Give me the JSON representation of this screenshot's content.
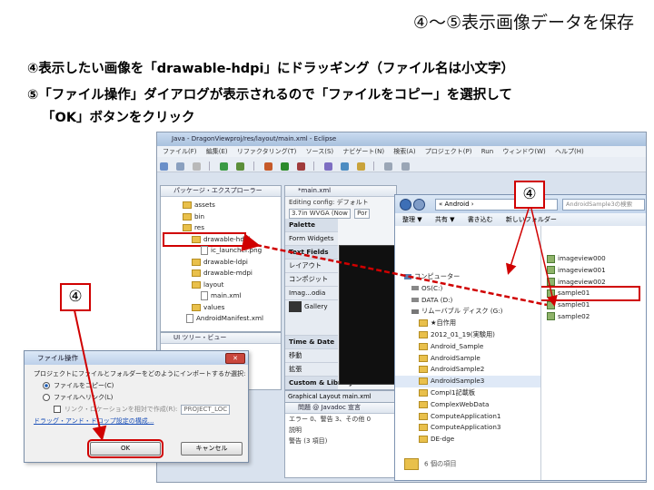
{
  "slide": {
    "title": "④～⑤表示画像データを保存",
    "instruction_1": "④表示したい画像を「drawable-hdpi」にドラッギング（ファイル名は小文字）",
    "instruction_2": "⑤「ファイル操作」ダイアログが表示されるので「ファイルをコピー」を選択して",
    "instruction_2b": "「OK」ボタンをクリック"
  },
  "callouts": {
    "left": "④",
    "right": "④"
  },
  "eclipse": {
    "title": "Java - DragonViewproj/res/layout/main.xml - Eclipse",
    "menu": [
      "ファイル(F)",
      "編集(E)",
      "リファクタリング(T)",
      "ソース(S)",
      "ナビゲート(N)",
      "検索(A)",
      "プロジェクト(P)",
      "Run",
      "ウィンドウ(W)",
      "ヘルプ(H)"
    ],
    "package_explorer_title": "パッケージ・エクスプローラー",
    "tree": [
      "assets",
      "bin",
      "res",
      "drawable-hdpi",
      "ic_launcher.png",
      "drawable-ldpi",
      "drawable-mdpi",
      "layout",
      "main.xml",
      "values",
      "AndroidManifest.xml"
    ],
    "editor_tab": "*main.xml",
    "config_label": "Editing config: デフォルト",
    "device": "3.7in WVGA (Now",
    "orientation": "Por",
    "palette": [
      "Palette",
      "Form Widgets",
      "Text Fields",
      "レイアウト",
      "コンポジット",
      "Images & Media",
      "Time & Date",
      "移動",
      "拡張",
      "Custom & Library Views"
    ],
    "media_items": [
      "Imag...odia",
      "Gallery"
    ],
    "ui_tree_title": "UI ツリー・ビュー",
    "editor_tabs": "Graphical Layout  main.xml",
    "console_tabs": "問題  @ Javadoc  宣言",
    "console_lines": [
      "エラー 0、警告 3、その他 0",
      "説明",
      "警告 (3 項目)"
    ]
  },
  "explorer": {
    "path": "« Android ›",
    "search_placeholder": "AndroidSample3の検索",
    "commands": [
      "整理 ▼",
      "共有 ▼",
      "書き込む",
      "新しいフォルダー"
    ],
    "nav": [
      "コンピューター",
      "OS(C:)",
      "DATA (D:)",
      "リムーバブル ディスク (G:)",
      "★自作用",
      "2012_01_19(実験用)",
      "Android_Sample",
      "AndroidSample",
      "AndroidSample2",
      "AndroidSample3",
      "Compl1記載板",
      "ComplexWebData",
      "ComputeApplication1",
      "ComputeApplication3",
      "DE-dge",
      "6 個の項目"
    ],
    "files": [
      "imageview000",
      "imageview001",
      "imageview002",
      "sample01",
      "sample01",
      "sample02"
    ]
  },
  "dialog": {
    "title": "ファイル操作",
    "question": "プロジェクトにファイルとフォルダーをどのようにインポートするか選択:",
    "option_copy": "ファイルをコピー(C)",
    "option_link": "ファイルへリンク(L)",
    "option_relative": "リンク・ロケーションを相対で作成(R):",
    "relative_var": "PROJECT_LOC",
    "link_text": "ドラッグ・アンド・ドロップ設定の構成...",
    "ok": "OK",
    "cancel": "キャンセル"
  }
}
